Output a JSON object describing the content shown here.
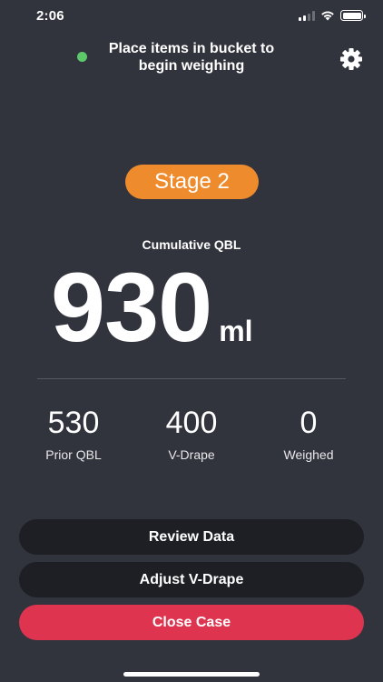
{
  "status_bar": {
    "time": "2:06"
  },
  "header": {
    "message": "Place items in bucket to begin weighing",
    "status_dot_color": "#5cc86a",
    "settings_icon": "gear-icon"
  },
  "stage": {
    "label": "Stage 2",
    "color": "#ee8b2d"
  },
  "cumulative": {
    "label": "Cumulative QBL",
    "value": "930",
    "unit": "ml"
  },
  "stats": [
    {
      "value": "530",
      "label": "Prior QBL"
    },
    {
      "value": "400",
      "label": "V-Drape"
    },
    {
      "value": "0",
      "label": "Weighed"
    }
  ],
  "buttons": {
    "review": "Review Data",
    "adjust": "Adjust V-Drape",
    "close": "Close Case"
  },
  "colors": {
    "background": "#32343d",
    "dark_button": "#1e1f25",
    "close_button": "#df3450"
  }
}
